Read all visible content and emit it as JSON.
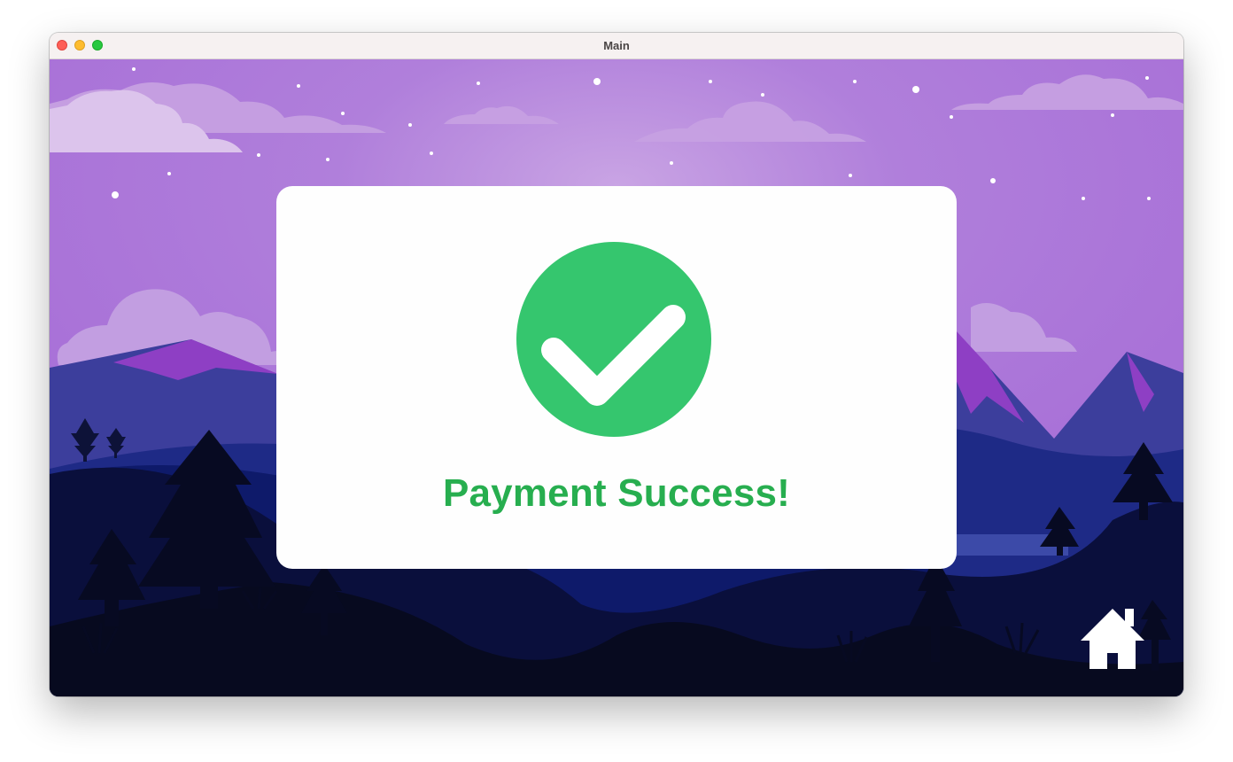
{
  "window": {
    "title": "Main",
    "controls": [
      "close",
      "minimize",
      "maximize"
    ]
  },
  "colors": {
    "sky": "#a972d8",
    "success_green": "#27ae4f",
    "badge_green": "#35c66e",
    "card_bg": "#fefefe"
  },
  "success_card": {
    "icon": "check-circle-icon",
    "message": "Payment Success!"
  },
  "home_button": {
    "icon": "home-icon"
  }
}
